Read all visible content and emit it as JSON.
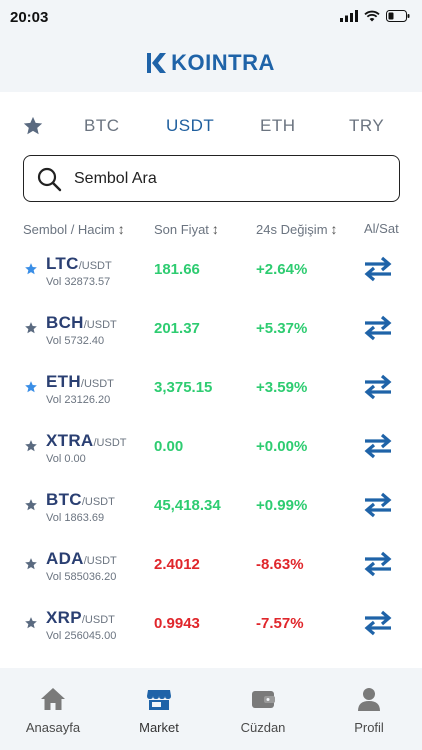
{
  "status": {
    "time": "20:03"
  },
  "header": {
    "logo_text": "KOINTRA"
  },
  "tabs": [
    {
      "label": "BTC",
      "active": false
    },
    {
      "label": "USDT",
      "active": true
    },
    {
      "label": "ETH",
      "active": false
    },
    {
      "label": "TRY",
      "active": false
    }
  ],
  "search": {
    "placeholder": "Sembol Ara",
    "value": ""
  },
  "columns": {
    "symbol_volume": "Sembol / Hacim",
    "last_price": "Son Fiyat",
    "change_24h": "24s Değişim",
    "buy_sell": "Al/Sat"
  },
  "rows": [
    {
      "symbol": "LTC",
      "quote": "/USDT",
      "volume": "Vol 32873.57",
      "price": "181.66",
      "change": "+2.64%",
      "favorite": true,
      "direction": "up"
    },
    {
      "symbol": "BCH",
      "quote": "/USDT",
      "volume": "Vol 5732.40",
      "price": "201.37",
      "change": "+5.37%",
      "favorite": false,
      "direction": "up"
    },
    {
      "symbol": "ETH",
      "quote": "/USDT",
      "volume": "Vol 23126.20",
      "price": "3,375.15",
      "change": "+3.59%",
      "favorite": true,
      "direction": "up"
    },
    {
      "symbol": "XTRA",
      "quote": "/USDT",
      "volume": "Vol 0.00",
      "price": "0.00",
      "change": "+0.00%",
      "favorite": false,
      "direction": "up"
    },
    {
      "symbol": "BTC",
      "quote": "/USDT",
      "volume": "Vol 1863.69",
      "price": "45,418.34",
      "change": "+0.99%",
      "favorite": false,
      "direction": "up"
    },
    {
      "symbol": "ADA",
      "quote": "/USDT",
      "volume": "Vol 585036.20",
      "price": "2.4012",
      "change": "-8.63%",
      "favorite": false,
      "direction": "down"
    },
    {
      "symbol": "XRP",
      "quote": "/USDT",
      "volume": "Vol 256045.00",
      "price": "0.9943",
      "change": "-7.57%",
      "favorite": false,
      "direction": "down"
    }
  ],
  "tabbar": [
    {
      "label": "Anasayfa",
      "icon": "home-icon",
      "active": false
    },
    {
      "label": "Market",
      "icon": "market-icon",
      "active": true
    },
    {
      "label": "Cüzdan",
      "icon": "wallet-icon",
      "active": false
    },
    {
      "label": "Profil",
      "icon": "profile-icon",
      "active": false
    }
  ],
  "colors": {
    "brand": "#1f63a8",
    "positive": "#2ecc71",
    "negative": "#e0262b",
    "favorite_star": "#3a8ee6",
    "unfavorite_star": "#5a6a80",
    "trade_icon": "#1f63a8"
  }
}
